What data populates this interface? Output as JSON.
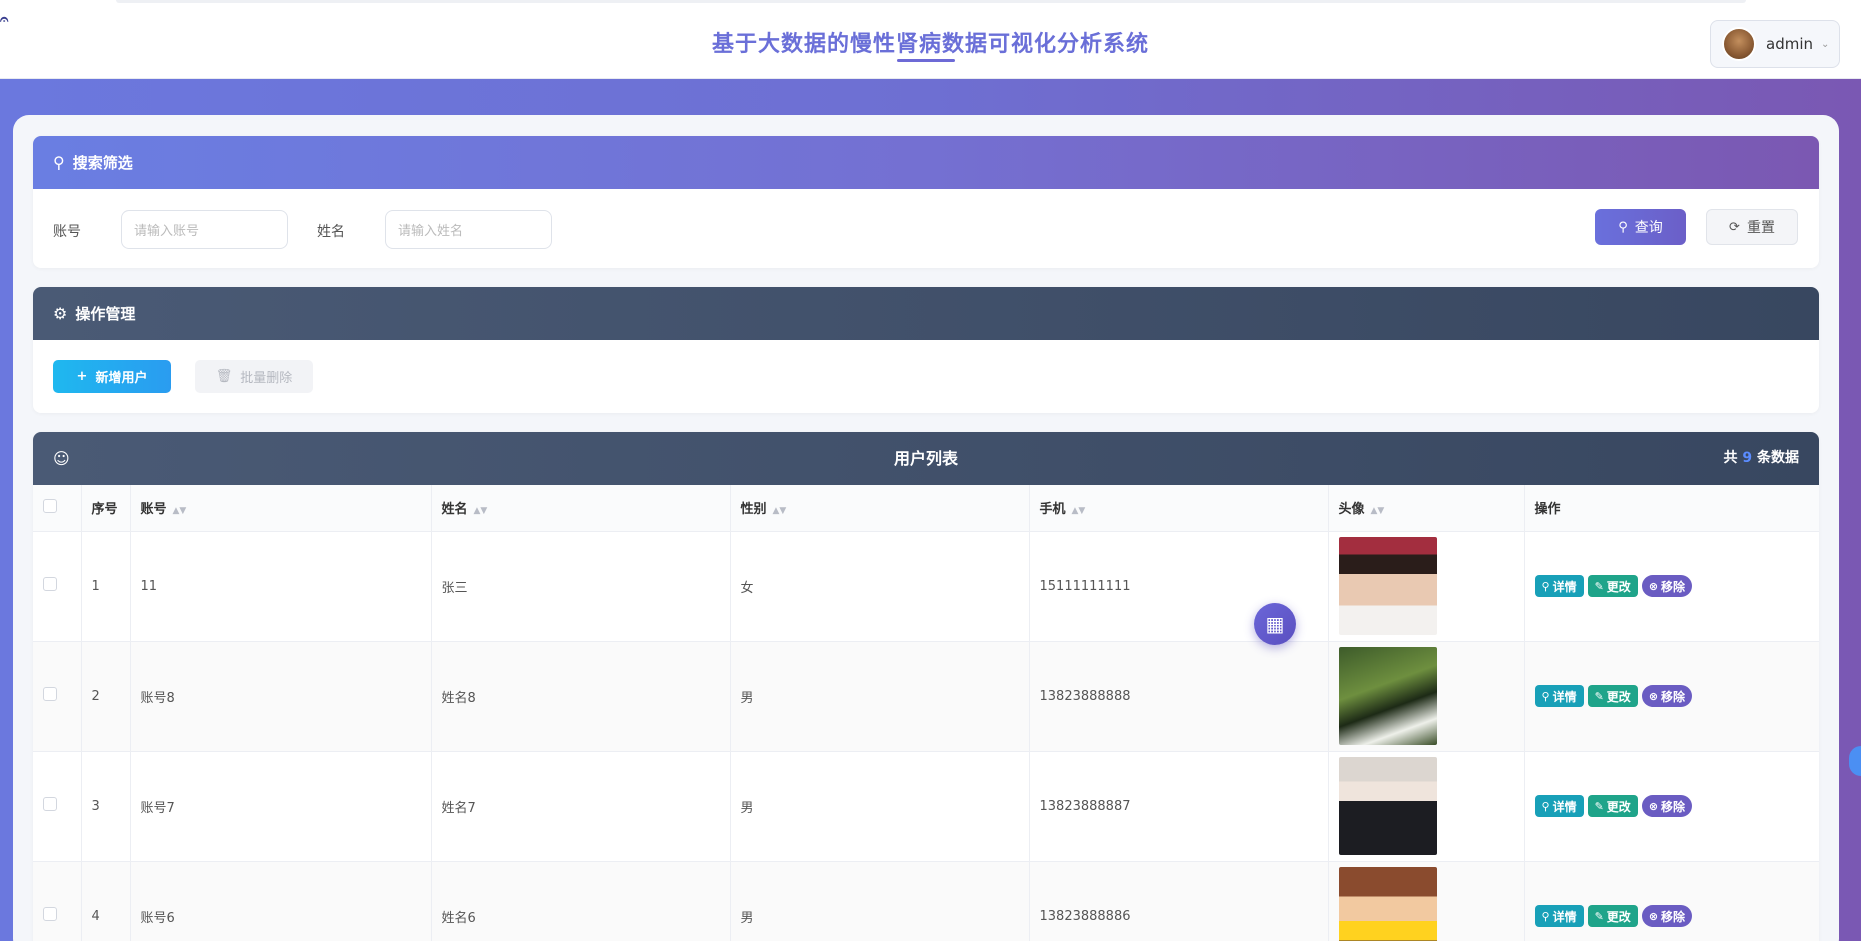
{
  "header": {
    "corner_glyph": "𝄐",
    "title": "基于大数据的慢性肾病数据可视化分析系统",
    "user_name": "admin"
  },
  "search": {
    "title": "搜索筛选",
    "account_label": "账号",
    "account_placeholder": "请输入账号",
    "name_label": "姓名",
    "name_placeholder": "请输入姓名",
    "query_label": "查询",
    "reset_label": "重置"
  },
  "operations": {
    "title": "操作管理",
    "add_label": "新增用户",
    "batch_delete_label": "批量删除"
  },
  "list": {
    "title": "用户列表",
    "count_prefix": "共",
    "count": "9",
    "count_suffix": "条数据",
    "columns": [
      "序号",
      "账号",
      "姓名",
      "性别",
      "手机",
      "头像",
      "操作"
    ],
    "rows": [
      {
        "index": "1",
        "account": "11",
        "name": "张三",
        "gender": "女",
        "phone": "15111111111"
      },
      {
        "index": "2",
        "account": "账号8",
        "name": "姓名8",
        "gender": "男",
        "phone": "13823888888"
      },
      {
        "index": "3",
        "account": "账号7",
        "name": "姓名7",
        "gender": "男",
        "phone": "13823888887"
      },
      {
        "index": "4",
        "account": "账号6",
        "name": "姓名6",
        "gender": "男",
        "phone": "13823888886"
      }
    ],
    "actions": {
      "detail": "详情",
      "edit": "更改",
      "remove": "移除"
    }
  },
  "icons": {
    "search": "search-icon",
    "settings": "gear-icon",
    "user": "user-icon",
    "plus": "plus-icon",
    "trash": "trash-icon",
    "refresh": "refresh-icon",
    "grid": "grid-icon"
  },
  "colors": {
    "accent": "#6a70dc",
    "detail": "#18a0b8",
    "edit": "#1fa48a",
    "remove": "#6a5cc2",
    "add": "#1fb8ef"
  }
}
